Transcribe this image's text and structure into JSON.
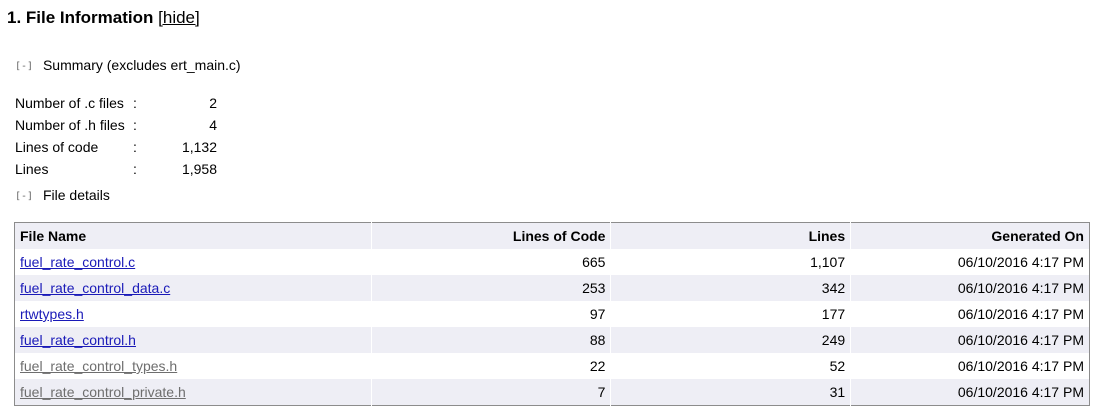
{
  "section": {
    "title": "1. File Information",
    "hide_label": "[hide]"
  },
  "summary": {
    "toggle": "[-]",
    "heading": "Summary (excludes ert_main.c)",
    "rows": [
      {
        "label": "Number of .c files",
        "sep": ":",
        "value": "2"
      },
      {
        "label": "Number of .h files",
        "sep": ":",
        "value": "4"
      },
      {
        "label": "Lines of code",
        "sep": ":",
        "value": "1,132"
      },
      {
        "label": "Lines",
        "sep": ":",
        "value": "1,958"
      }
    ]
  },
  "file_details": {
    "toggle": "[-]",
    "heading": "File details",
    "columns": [
      "File Name",
      "Lines of Code",
      "Lines",
      "Generated On"
    ],
    "rows": [
      {
        "name": "fuel_rate_control.c",
        "loc": "665",
        "lines": "1,107",
        "generated": "06/10/2016 4:17 PM",
        "link_color": "#1a1ab8"
      },
      {
        "name": "fuel_rate_control_data.c",
        "loc": "253",
        "lines": "342",
        "generated": "06/10/2016 4:17 PM",
        "link_color": "#1a1ab8"
      },
      {
        "name": "rtwtypes.h",
        "loc": "97",
        "lines": "177",
        "generated": "06/10/2016 4:17 PM",
        "link_color": "#1a1ab8"
      },
      {
        "name": "fuel_rate_control.h",
        "loc": "88",
        "lines": "249",
        "generated": "06/10/2016 4:17 PM",
        "link_color": "#1a1ab8"
      },
      {
        "name": "fuel_rate_control_types.h",
        "loc": "22",
        "lines": "52",
        "generated": "06/10/2016 4:17 PM",
        "link_color": "#6e6e6e"
      },
      {
        "name": "fuel_rate_control_private.h",
        "loc": "7",
        "lines": "31",
        "generated": "06/10/2016 4:17 PM",
        "link_color": "#6e6e6e"
      }
    ]
  },
  "colors": {
    "link": "#1a1ab8",
    "link_dim": "#6e6e6e",
    "row_alt": "#eeeef5",
    "table_border": "#8c8c8c"
  }
}
